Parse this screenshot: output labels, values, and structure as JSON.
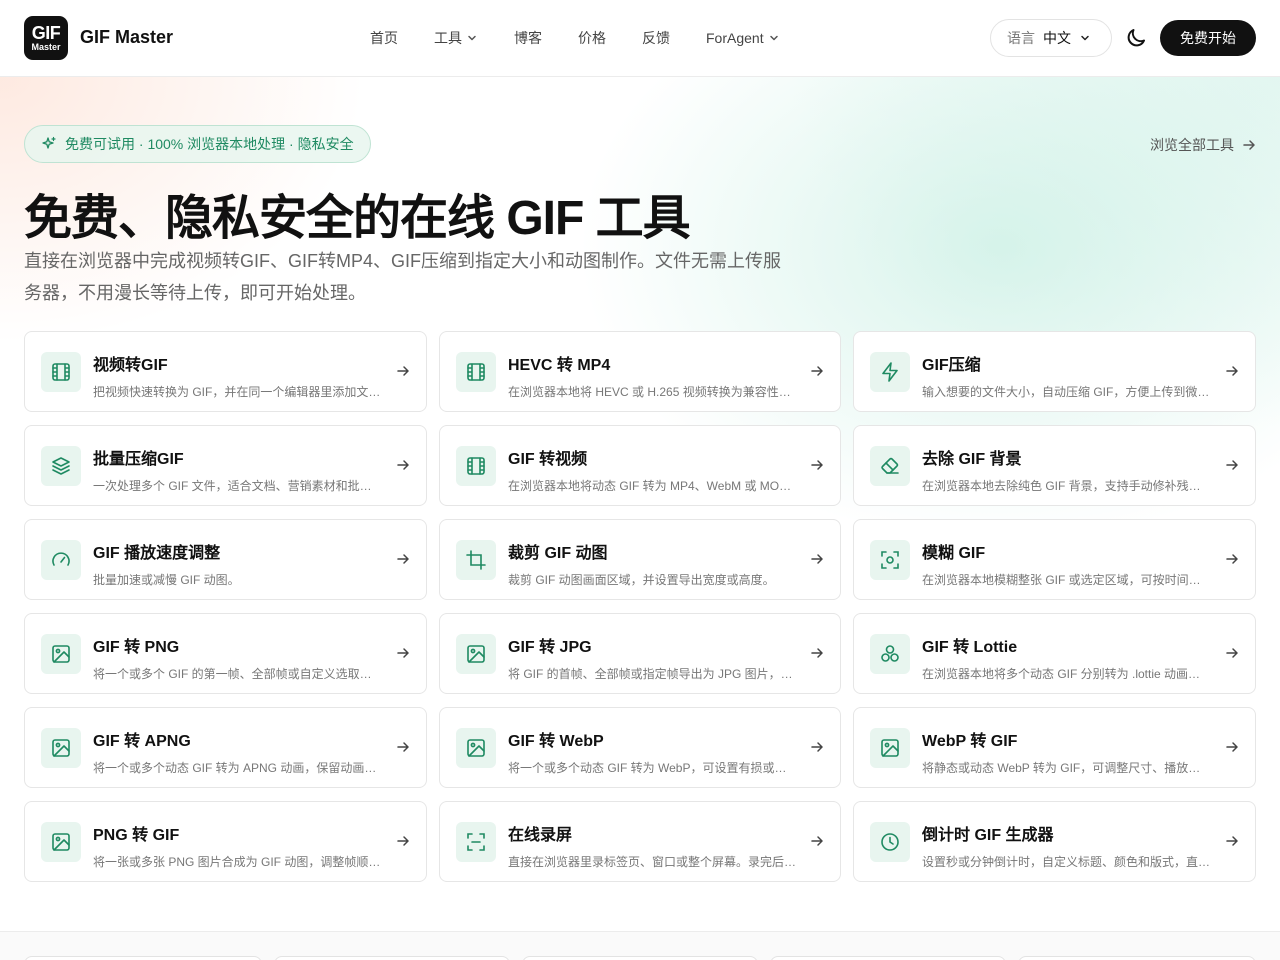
{
  "header": {
    "logo_line1": "GIF",
    "logo_line2": "Master",
    "brand": "GIF Master",
    "nav": [
      {
        "label": "首页",
        "dropdown": false
      },
      {
        "label": "工具",
        "dropdown": true
      },
      {
        "label": "博客",
        "dropdown": false
      },
      {
        "label": "价格",
        "dropdown": false
      },
      {
        "label": "反馈",
        "dropdown": false
      },
      {
        "label": "ForAgent",
        "dropdown": true
      }
    ],
    "language_label": "语言",
    "language_value": "中文",
    "cta": "免费开始"
  },
  "hero": {
    "badge": "免费可试用 · 100% 浏览器本地处理 · 隐私安全",
    "browse_all": "浏览全部工具",
    "title": "免费、隐私安全的在线 GIF 工具",
    "subtitle": "直接在浏览器中完成视频转GIF、GIF转MP4、GIF压缩到指定大小和动图制作。文件无需上传服务器，不用漫长等待上传，即可开始处理。"
  },
  "colors": {
    "accent": "#1f8a62",
    "icon_bg": "#e8f5ef",
    "dark": "#111111"
  },
  "tools": [
    {
      "title": "视频转GIF",
      "desc": "把视频快速转换为 GIF，并在同一个编辑器里添加文…",
      "icon": "film-icon"
    },
    {
      "title": "HEVC 转 MP4",
      "desc": "在浏览器本地将 HEVC 或 H.265 视频转换为兼容性…",
      "icon": "film-icon"
    },
    {
      "title": "GIF压缩",
      "desc": "输入想要的文件大小，自动压缩 GIF，方便上传到微…",
      "icon": "bolt-icon"
    },
    {
      "title": "批量压缩GIF",
      "desc": "一次处理多个 GIF 文件，适合文档、营销素材和批量…",
      "icon": "layers-icon"
    },
    {
      "title": "GIF 转视频",
      "desc": "在浏览器本地将动态 GIF 转为 MP4、WebM 或 MO…",
      "icon": "film-icon"
    },
    {
      "title": "去除 GIF 背景",
      "desc": "在浏览器本地去除纯色 GIF 背景，支持手动修补残留…",
      "icon": "eraser-icon"
    },
    {
      "title": "GIF 播放速度调整",
      "desc": "批量加速或减慢 GIF 动图。",
      "icon": "gauge-icon"
    },
    {
      "title": "裁剪 GIF 动图",
      "desc": "裁剪 GIF 动图画面区域，并设置导出宽度或高度。",
      "icon": "crop-icon"
    },
    {
      "title": "模糊 GIF",
      "desc": "在浏览器本地模糊整张 GIF 或选定区域，可按时间隐…",
      "icon": "focus-icon"
    },
    {
      "title": "GIF 转 PNG",
      "desc": "将一个或多个 GIF 的第一帧、全部帧或自定义选取的…",
      "icon": "image-icon"
    },
    {
      "title": "GIF 转 JPG",
      "desc": "将 GIF 的首帧、全部帧或指定帧导出为 JPG 图片，…",
      "icon": "image-icon"
    },
    {
      "title": "GIF 转 Lottie",
      "desc": "在浏览器本地将多个动态 GIF 分别转为 .lottie 动画…",
      "icon": "shapes-icon"
    },
    {
      "title": "GIF 转 APNG",
      "desc": "将一个或多个动态 GIF 转为 APNG 动画，保留动画…",
      "icon": "image-icon"
    },
    {
      "title": "GIF 转 WebP",
      "desc": "将一个或多个动态 GIF 转为 WebP，可设置有损或…",
      "icon": "image-icon"
    },
    {
      "title": "WebP 转 GIF",
      "desc": "将静态或动态 WebP 转为 GIF，可调整尺寸、播放…",
      "icon": "image-icon"
    },
    {
      "title": "PNG 转 GIF",
      "desc": "将一张或多张 PNG 图片合成为 GIF 动图，调整帧顺…",
      "icon": "image-icon"
    },
    {
      "title": "在线录屏",
      "desc": "直接在浏览器里录标签页、窗口或整个屏幕。录完后…",
      "icon": "scan-icon"
    },
    {
      "title": "倒计时 GIF 生成器",
      "desc": "设置秒或分钟倒计时，自定义标题、颜色和版式，直…",
      "icon": "clock-icon"
    }
  ]
}
